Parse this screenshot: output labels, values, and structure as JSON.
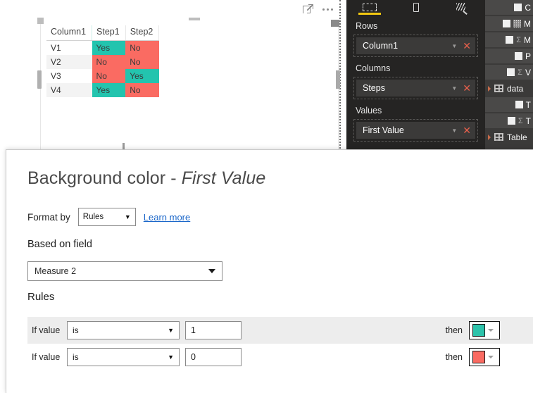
{
  "canvas": {
    "visual_toolbar": {
      "focus_icon": "focus-mode-icon",
      "more_icon": "more-options-icon"
    },
    "matrix": {
      "columns": [
        "Column1",
        "Step1",
        "Step2"
      ],
      "rows": [
        {
          "header": "V1",
          "cells": [
            {
              "text": "Yes",
              "color": "#23c4ae"
            },
            {
              "text": "No",
              "color": "#fa6b62"
            }
          ]
        },
        {
          "header": "V2",
          "cells": [
            {
              "text": "No",
              "color": "#fa6b62"
            },
            {
              "text": "No",
              "color": "#fa6b62"
            }
          ]
        },
        {
          "header": "V3",
          "cells": [
            {
              "text": "No",
              "color": "#fa6b62"
            },
            {
              "text": "Yes",
              "color": "#23c4ae"
            }
          ]
        },
        {
          "header": "V4",
          "cells": [
            {
              "text": "Yes",
              "color": "#23c4ae"
            },
            {
              "text": "No",
              "color": "#fa6b62"
            }
          ]
        }
      ]
    }
  },
  "visualizations_panel": {
    "tabs": [
      {
        "name": "fields-tab",
        "icon": "field-well-icon",
        "active": true
      },
      {
        "name": "format-tab",
        "icon": "paint-roller-icon",
        "active": false
      },
      {
        "name": "analytics-tab",
        "icon": "magnifier-icon",
        "active": false
      }
    ],
    "accent": "#f2c811",
    "wells": [
      {
        "label": "Rows",
        "field": "Column1"
      },
      {
        "label": "Columns",
        "field": "Steps"
      },
      {
        "label": "Values",
        "field": "First Value"
      }
    ]
  },
  "fields_panel": {
    "rows": [
      {
        "type": "field",
        "checkbox": true,
        "icon": "",
        "label": "C"
      },
      {
        "type": "field",
        "checkbox": true,
        "icon": "calc",
        "label": "M"
      },
      {
        "type": "measure",
        "checkbox": true,
        "icon": "sigma",
        "label": "M"
      },
      {
        "type": "field",
        "checkbox": true,
        "icon": "",
        "label": "P"
      },
      {
        "type": "measure",
        "checkbox": true,
        "icon": "sigma",
        "label": "V"
      },
      {
        "type": "table",
        "checkbox": false,
        "icon": "grid",
        "label": "data"
      },
      {
        "type": "field",
        "checkbox": true,
        "icon": "",
        "label": "T"
      },
      {
        "type": "measure",
        "checkbox": true,
        "icon": "sigma",
        "label": "T"
      },
      {
        "type": "table",
        "checkbox": false,
        "icon": "grid",
        "label": "Table"
      }
    ]
  },
  "dialog": {
    "title_prefix": "Background color - ",
    "title_field": "First Value",
    "format_by_label": "Format by",
    "format_by_value": "Rules",
    "learn_more": "Learn more",
    "based_on_field_label": "Based on field",
    "based_on_field_value": "Measure 2",
    "rules_label": "Rules",
    "rules": [
      {
        "if_label": "If value",
        "operator": "is",
        "value": "1",
        "then_label": "then",
        "color": "#2dc3ab",
        "highlighted": true
      },
      {
        "if_label": "If value",
        "operator": "is",
        "value": "0",
        "then_label": "then",
        "color": "#fa6b62",
        "highlighted": false
      }
    ]
  }
}
